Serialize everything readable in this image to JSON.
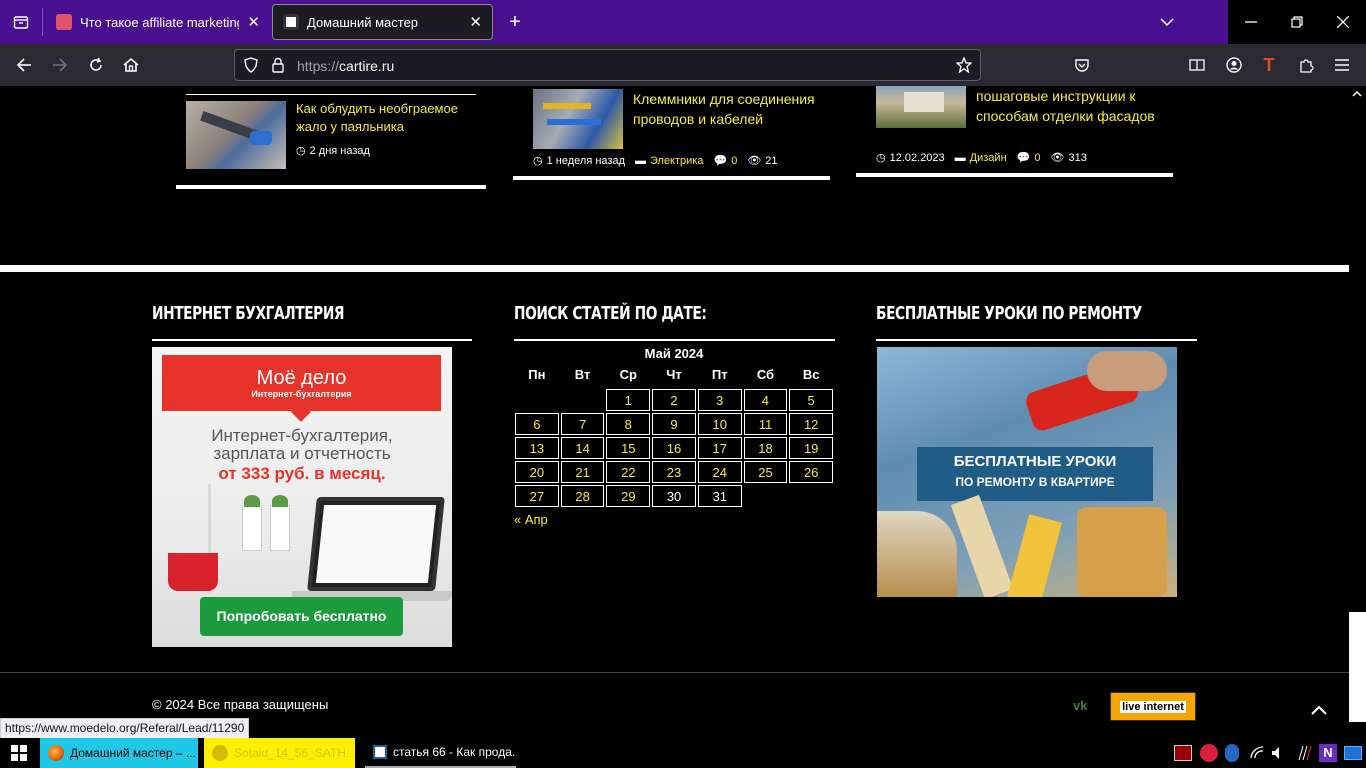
{
  "browser": {
    "tabs": [
      {
        "title": "Что такое affiliate marketing –",
        "active": false
      },
      {
        "title": "Домашний мастер",
        "active": true
      }
    ],
    "new_tab": "+",
    "url_prefix": "https://",
    "url_host": "cartire.ru",
    "status_url": "https://www.moedelo.org/Referal/Lead/11290"
  },
  "articles": [
    {
      "title": "Как облудить необграемое жало у паяльника",
      "date": "2 дня назад"
    },
    {
      "title": "Клеммники для соединения проводов и кабелей",
      "date": "1 неделя назад",
      "category": "Электрика",
      "comments": "0",
      "views": "21"
    },
    {
      "title": "пошаговые инструкции к способам отделки фасадов",
      "date": "12.02.2023",
      "category": "Дизайн",
      "comments": "0",
      "views": "313"
    }
  ],
  "widgets": {
    "accounting": {
      "title": "Интернет бухгалтерия",
      "ad_brand": "Моё дело",
      "ad_brand_sub": "Интернет-бухгалтерия",
      "ad_line1": "Интернет-бухгалтерия,",
      "ad_line2": "зарплата и отчетность",
      "ad_price": "от 333 руб. в месяц.",
      "ad_button": "Попробовать бесплатно"
    },
    "calendar": {
      "title": "Поиск статей по дате:",
      "caption": "Май 2024",
      "days": [
        "Пн",
        "Вт",
        "Ср",
        "Чт",
        "Пт",
        "Сб",
        "Вс"
      ],
      "weeks": [
        [
          "",
          "",
          "1",
          "2",
          "3",
          "4",
          "5"
        ],
        [
          "6",
          "7",
          "8",
          "9",
          "10",
          "11",
          "12"
        ],
        [
          "13",
          "14",
          "15",
          "16",
          "17",
          "18",
          "19"
        ],
        [
          "20",
          "21",
          "22",
          "23",
          "24",
          "25",
          "26"
        ],
        [
          "27",
          "28",
          "29",
          "30",
          "31",
          "",
          ""
        ]
      ],
      "linked_days": [
        "1",
        "2",
        "3",
        "4",
        "5",
        "6",
        "7",
        "8",
        "9",
        "10",
        "11",
        "12",
        "13",
        "14",
        "15",
        "16",
        "17",
        "18",
        "19",
        "20",
        "21",
        "22",
        "23",
        "24",
        "25",
        "26",
        "27",
        "28",
        "29"
      ],
      "prev_link": "« Апр"
    },
    "repair": {
      "title": "Бесплатные уроки по ремонту",
      "banner_line1": "БЕСПЛАТНЫЕ УРОКИ",
      "banner_line2": "ПО РЕМОНТУ В КВАРТИРЕ"
    }
  },
  "footer": {
    "copyright": "© 2024 Все права защищены",
    "vk": "vk",
    "counter_text": "live internet"
  },
  "taskbar": {
    "items": [
      {
        "label": "Домашний мастер – ..."
      },
      {
        "label": "Sotaiu_14_56_SATH..."
      },
      {
        "label": "статья 66 - Как прода..."
      }
    ]
  },
  "colors": {
    "tab_bar": "#4a0e91",
    "accent_yellow": "#f4ec3f",
    "moedelo_red": "#e8332a",
    "moedelo_green": "#1b9a3e"
  }
}
